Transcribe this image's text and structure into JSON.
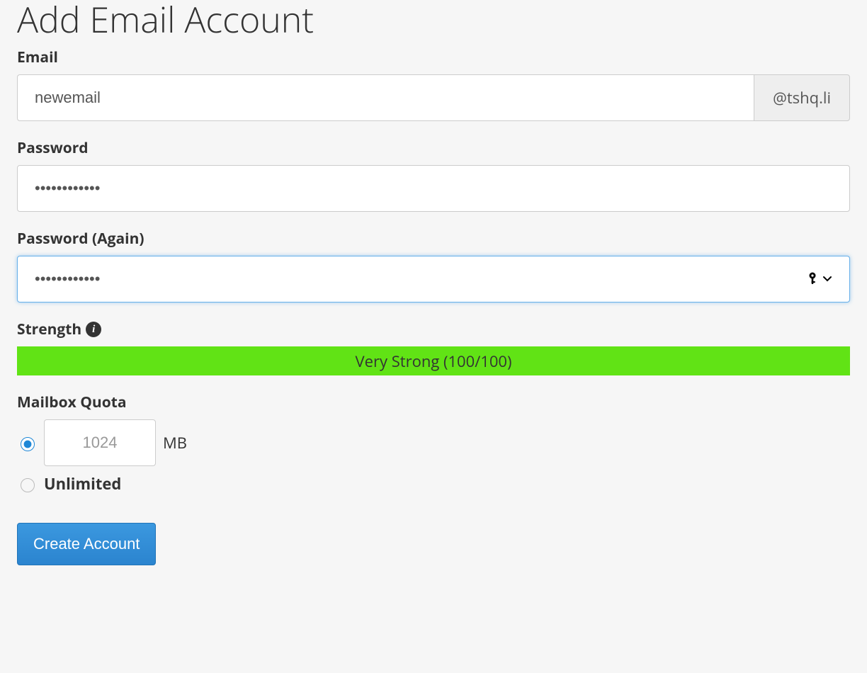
{
  "page_title": "Add Email Account",
  "email": {
    "label": "Email",
    "value": "newemail",
    "domain_suffix": "@tshq.li"
  },
  "password": {
    "label": "Password",
    "value": "••••••••••••"
  },
  "password_again": {
    "label": "Password (Again)",
    "value": "••••••••••••"
  },
  "strength": {
    "label": "Strength",
    "value_text": "Very Strong (100/100)",
    "bar_color": "#61e315"
  },
  "quota": {
    "label": "Mailbox Quota",
    "value": "1024",
    "unit": "MB",
    "unlimited_label": "Unlimited"
  },
  "submit_label": "Create Account"
}
